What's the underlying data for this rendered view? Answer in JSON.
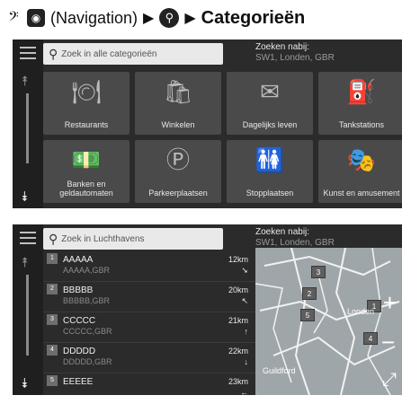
{
  "header": {
    "voice_icon": "voice-command-icon",
    "nav_icon": "navigation-icon",
    "nav_label": "(Navigation)",
    "arrow1": "▶",
    "search_icon": "search-icon",
    "arrow2": "▶",
    "title": "Categorieën"
  },
  "screen1": {
    "search_placeholder": "Zoek in alle categorieën",
    "near_label": "Zoeken nabij:",
    "near_value": "SW1, Londen, GBR",
    "tiles": [
      {
        "label": "Restaurants",
        "icon": "restaurant-icon"
      },
      {
        "label": "Winkelen",
        "icon": "shopping-icon"
      },
      {
        "label": "Dagelijks leven",
        "icon": "daily-life-icon"
      },
      {
        "label": "Tankstations",
        "icon": "fuel-icon"
      },
      {
        "label": "Banken en geldautomaten",
        "icon": "bank-icon"
      },
      {
        "label": "Parkeerplaatsen",
        "icon": "parking-icon"
      },
      {
        "label": "Stopplaatsen",
        "icon": "restroom-icon"
      },
      {
        "label": "Kunst en amusement",
        "icon": "theater-icon"
      }
    ]
  },
  "screen2": {
    "search_placeholder": "Zoek in Luchthavens",
    "near_label": "Zoeken nabij:",
    "near_value": "SW1, Londen, GBR",
    "results": [
      {
        "num": "1",
        "name": "AAAAA",
        "sub": "AAAAA,GBR",
        "dist": "12km",
        "dir": "➘"
      },
      {
        "num": "2",
        "name": "BBBBB",
        "sub": "BBBBB,GBR",
        "dist": "20km",
        "dir": "↖"
      },
      {
        "num": "3",
        "name": "CCCCC",
        "sub": "CCCCC,GBR",
        "dist": "21km",
        "dir": "↑"
      },
      {
        "num": "4",
        "name": "DDDDD",
        "sub": "DDDDD,GBR",
        "dist": "22km",
        "dir": "↓"
      },
      {
        "num": "5",
        "name": "EEEEE",
        "sub": "",
        "dist": "23km",
        "dir": "←"
      }
    ],
    "map": {
      "city_label": "Londen",
      "city2_label": "Guildford",
      "pins": [
        "1",
        "2",
        "3",
        "4",
        "5"
      ],
      "zoom_in": "+",
      "zoom_out": "−",
      "fullscreen": "⤢"
    }
  }
}
